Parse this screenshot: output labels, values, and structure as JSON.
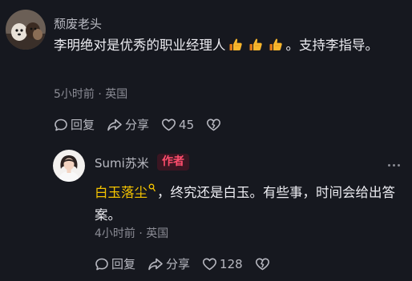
{
  "comments": [
    {
      "username": "颓废老头",
      "text_before": "李明绝对是优秀的职业经理人",
      "text_after": "。支持李指导。",
      "meta": "5小时前 · 英国",
      "reply_label": "回复",
      "share_label": "分享",
      "like_count": "45"
    },
    {
      "username": "Sumi苏米",
      "badge": "作者",
      "mention": "白玉落尘",
      "text": "，终究还是白玉。有些事，时间会给出答案。",
      "meta": "4小时前 · 英国",
      "reply_label": "回复",
      "share_label": "分享",
      "like_count": "128"
    }
  ],
  "colors": {
    "background": "#16181f",
    "author_badge": "#ff4d6d",
    "mention": "#f5c400"
  },
  "icons": [
    "avatar-dog",
    "avatar-woman",
    "thumbs-up-icon",
    "more-icon",
    "mention-icon",
    "comment-icon",
    "share-icon",
    "heart-icon",
    "dislike-heart-icon"
  ]
}
